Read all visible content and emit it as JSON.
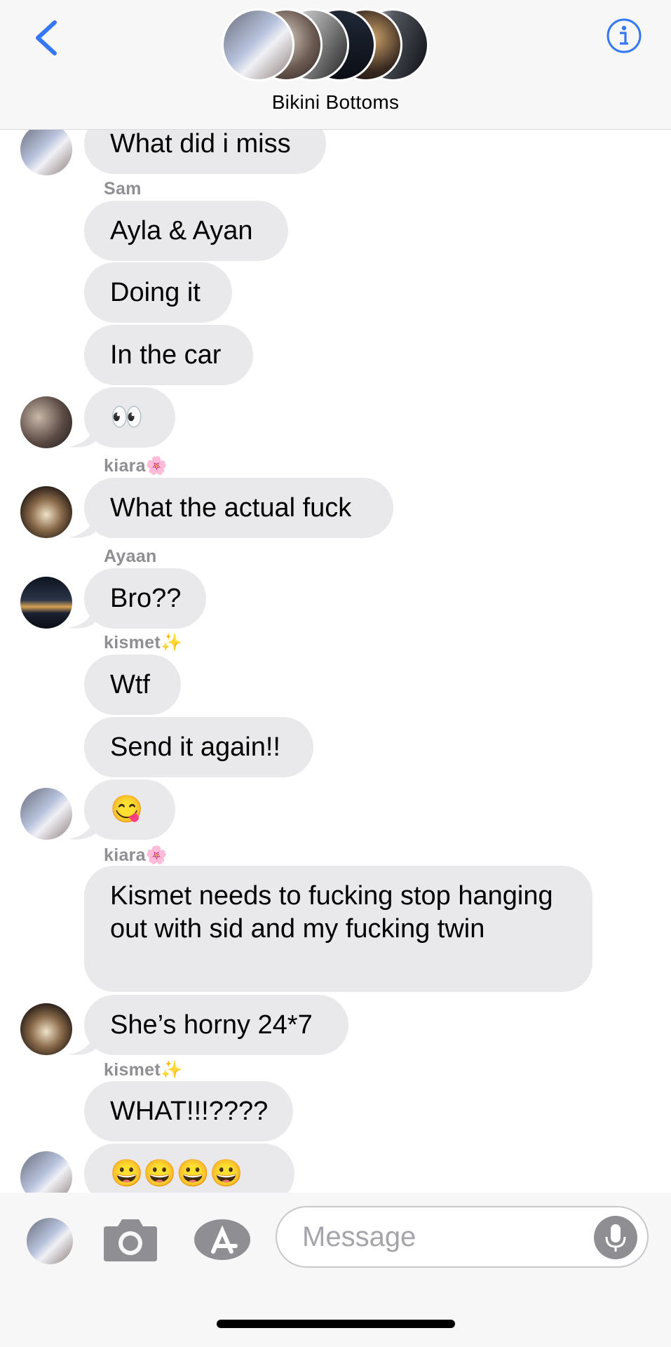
{
  "header": {
    "group_name": "Bikini Bottoms",
    "back_icon": "chevron-left-icon",
    "info_icon": "info-icon"
  },
  "colors": {
    "accent": "#3478f6",
    "bubble": "#e9e9eb",
    "sender_label": "#8e8e93"
  },
  "messages": [
    {
      "text": "What did i miss"
    },
    {
      "sender": "Sam",
      "text": "Ayla & Ayan"
    },
    {
      "text": "Doing it"
    },
    {
      "text": "In the car"
    },
    {
      "text": "👀"
    },
    {
      "sender": "kiara🌸",
      "text": "What the actual fuck"
    },
    {
      "sender": "Ayaan",
      "text": "Bro??"
    },
    {
      "sender": "kismet✨",
      "text": "Wtf"
    },
    {
      "text": "Send it again!!"
    },
    {
      "text": "😋"
    },
    {
      "sender": "kiara🌸",
      "text": "Kismet needs to fucking stop hanging out with sid and my fucking twin"
    },
    {
      "text": "She’s horny 24*7"
    },
    {
      "sender": "kismet✨",
      "text": "WHAT!!!????"
    },
    {
      "text": "😀😀😀😀"
    }
  ],
  "composer": {
    "placeholder": "Message",
    "camera_icon": "camera-icon",
    "apps_icon": "app-store-icon",
    "mic_icon": "microphone-icon"
  }
}
